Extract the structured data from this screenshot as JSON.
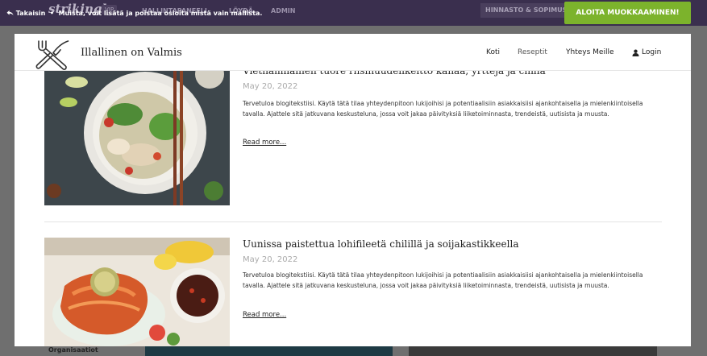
{
  "admin_bar": {
    "logo": "strikingly",
    "vip": "VIP",
    "nav": [
      "HALLINTAPANEELI",
      "LÖYDÄ",
      "ADMIN"
    ],
    "billing": "HINNASTO & SOPIMUS",
    "back_label": "Takaisin",
    "notice": "Muista, voit lisätä ja poistaa osioita mistä vain mallista.",
    "start_button": "ALOITA MUOKKAAMINEN!"
  },
  "site": {
    "title": "Illallinen on Valmis",
    "nav": [
      "Koti",
      "Reseptit",
      "Yhteys Meille"
    ],
    "login": "Login"
  },
  "posts": [
    {
      "title": "Vietnamilainen tuore riisinuudelikeitto kanaa, yrttejä ja chiliä",
      "date": "May 20, 2022",
      "body": "Tervetuloa blogitekstiisi. Käytä tätä tilaa yhteydenpitoon lukijoihisi ja potentiaalisiin asiakkaisiisi ajankohtaisella ja mielenkiintoisella tavalla. Ajattele sitä jatkuvana keskusteluna, jossa voit jakaa päivityksiä liiketoiminnasta, trendeistä, uutisista ja muusta.",
      "read_more": "Read more..."
    },
    {
      "title": "Uunissa paistettua lohifileetä chilillä ja soijakastikkeella",
      "date": "May 20, 2022",
      "body": "Tervetuloa blogitekstiisi. Käytä tätä tilaa yhteydenpitoon lukijoihisi ja potentiaalisiin asiakkaisiisi ajankohtaisella ja mielenkiintoisella tavalla. Ajattele sitä jatkuvana keskusteluna, jossa voit jakaa päivityksiä liiketoiminnasta, trendeistä, uutisista ja muusta.",
      "read_more": "Read more..."
    }
  ],
  "background": {
    "org_label": "Organisaatiot"
  },
  "colors": {
    "admin_bar": "#3a2f4e",
    "start_button": "#7cb32c",
    "overlay": "#6f6f6f"
  },
  "icons": {
    "back": "back-arrow-icon",
    "logo": "fork-knife-icon",
    "login": "user-icon"
  }
}
